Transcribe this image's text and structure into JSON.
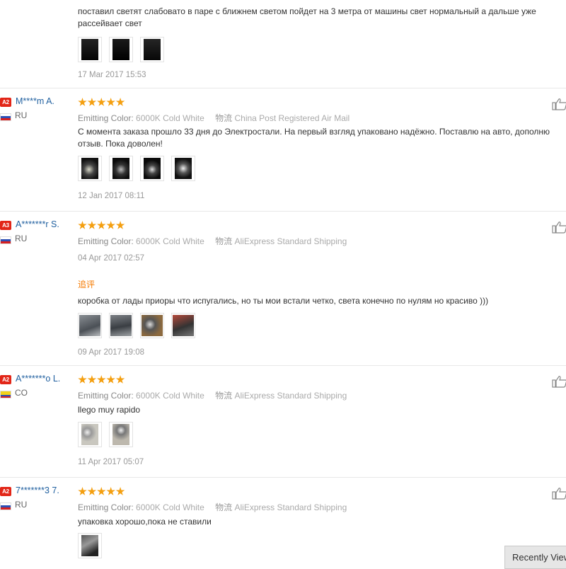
{
  "top": {
    "text": "поставил светят слабовато в паре с ближнем светом пойдет на 3 метра от машины свет нормальный а дальше уже рассейвает свет",
    "date": "17 Mar 2017 15:53"
  },
  "reviews": [
    {
      "level": "A2",
      "name": "M****m A.",
      "country": "RU",
      "rating": 5,
      "attr_label": "Emitting Color:",
      "attr_value": "6000K Cold White",
      "ship_label": "物流",
      "ship_value": "China Post Registered Air Mail",
      "text": "С момента заказа прошло 33 дня до Электростали. На первый взгляд упаковано надёжно. Поставлю на авто, дополню отзыв. Пока доволен!",
      "date": "12 Jan 2017 08:11"
    },
    {
      "level": "A3",
      "name": "A*******r S.",
      "country": "RU",
      "rating": 5,
      "attr_label": "Emitting Color:",
      "attr_value": "6000K Cold White",
      "ship_label": "物流",
      "ship_value": "AliExpress Standard Shipping",
      "date": "04 Apr 2017 02:57",
      "additional_label": "追评",
      "additional_text": "коробка от лады приоры что испугались, но ты мои встали четко, света конечно по нулям но красиво )))",
      "additional_date": "09 Apr 2017 19:08"
    },
    {
      "level": "A2",
      "name": "A*******o L.",
      "country": "CO",
      "rating": 5,
      "attr_label": "Emitting Color:",
      "attr_value": "6000K Cold White",
      "ship_label": "物流",
      "ship_value": "AliExpress Standard Shipping",
      "text": "llego muy rapido",
      "date": "11 Apr 2017 05:07"
    },
    {
      "level": "A2",
      "name": "7*******3 7.",
      "country": "RU",
      "rating": 5,
      "attr_label": "Emitting Color:",
      "attr_value": "6000K Cold White",
      "ship_label": "物流",
      "ship_value": "AliExpress Standard Shipping",
      "text": "упаковка хорошо,пока не ставили"
    }
  ],
  "recently_viewed": "Recently Viewed",
  "colors": {
    "level_badge": "#e22618",
    "username": "#1f5f9f",
    "star": "#f49f10",
    "additional": "#f57a00"
  },
  "icons": {
    "like": "thumbs-up-icon",
    "star": "star-icon",
    "flag": "flag-icon"
  }
}
